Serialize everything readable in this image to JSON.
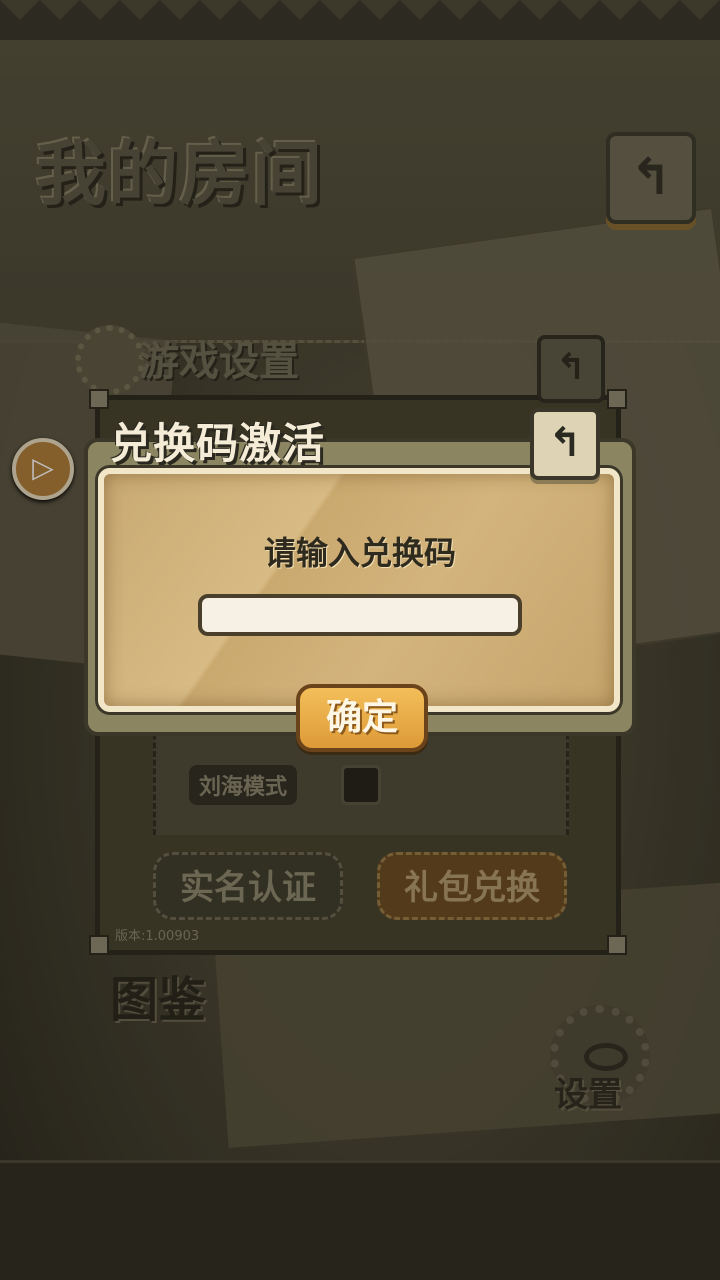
{
  "background": {
    "room_title": "我的房间",
    "back_glyph": "↰",
    "side_arrow_glyph": "▷",
    "bottom_label": "图鉴",
    "settings_label": "设置"
  },
  "settings_dialog": {
    "title": "游戏设置",
    "back_glyph": "↰",
    "notch_mode_label": "刘海模式",
    "realname_button": "实名认证",
    "gift_button": "礼包兑换",
    "version": "版本:1.00903"
  },
  "redeem_dialog": {
    "title": "兑换码激活",
    "back_glyph": "↰",
    "prompt": "请输入兑换码",
    "input_value": "",
    "input_placeholder": "",
    "confirm_button": "确定"
  },
  "colors": {
    "accent_orange": "#e9a944",
    "parchment": "#d3b47c",
    "dark_frame": "#3b3829"
  }
}
